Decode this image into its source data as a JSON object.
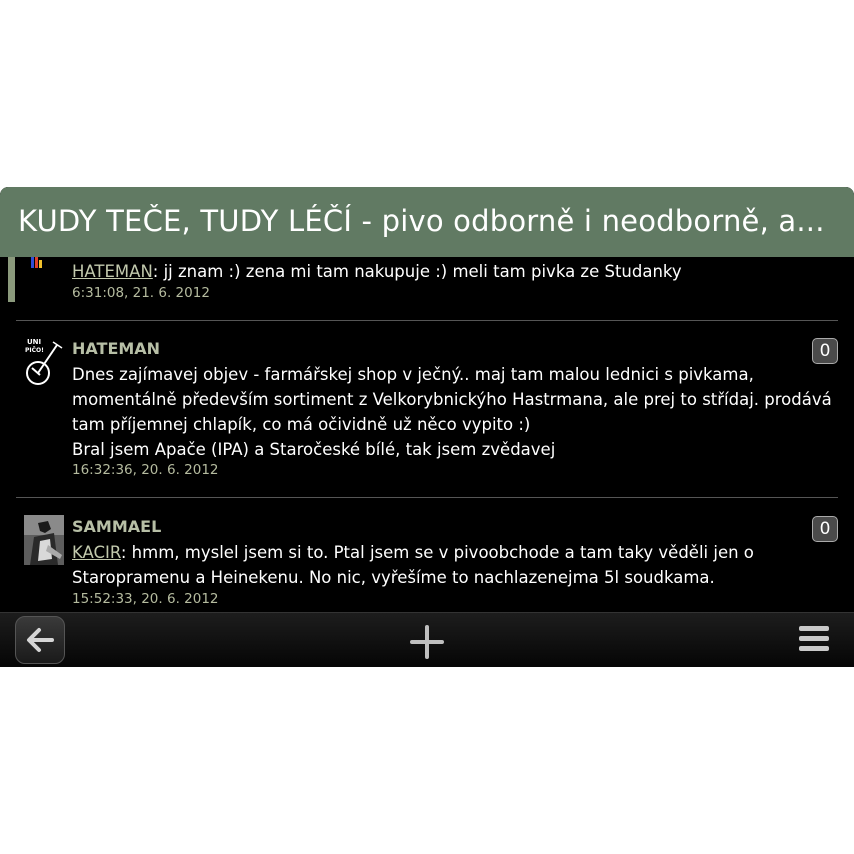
{
  "header": {
    "title": "KUDY TEČE, TUDY LÉČÍ - pivo odborně i neodborně, a..."
  },
  "posts": [
    {
      "author": "",
      "mention": "HATEMAN",
      "text": ": jj znam :) zena mi tam nakupuje :) meli tam pivka ze Studanky",
      "timestamp": "6:31:08, 21. 6. 2012"
    },
    {
      "author": "HATEMAN",
      "avatar": "uni-pico-logo",
      "avatar_text": "UNI PIČO!",
      "likes": "0",
      "line1": "Dnes zajímavej objev - farmářskej shop v ječný.. maj tam malou lednici s pivkama, momentálně především sortiment z Velkorybnickýho Hastrmana, ale prej to střídaj. prodává tam příjemnej chlapík, co má očividně už něco vypito :)",
      "line2": "Bral jsem Apače (IPA) a Staročeské bílé, tak jsem zvědavej",
      "timestamp": "16:32:36, 20. 6. 2012"
    },
    {
      "author": "SAMMAEL",
      "avatar": "user-photo",
      "likes": "0",
      "mention": "KACIR",
      "text": ": hmm, myslel jsem si to. Ptal jsem se v pivoobchode a tam taky věděli jen o Staropramenu a Heinekenu. No nic, vyřešíme to nachlazenejma 5l soudkama.",
      "timestamp": "15:52:33, 20. 6. 2012"
    }
  ],
  "toolbar": {
    "back_icon": "arrow-left-icon",
    "add_icon": "plus-icon",
    "menu_icon": "menu-icon"
  },
  "colors": {
    "header_bg": "#617a63",
    "username": "#b7bfa6",
    "timestamp": "#b5bb9f",
    "accent": "#8b9a7c"
  }
}
